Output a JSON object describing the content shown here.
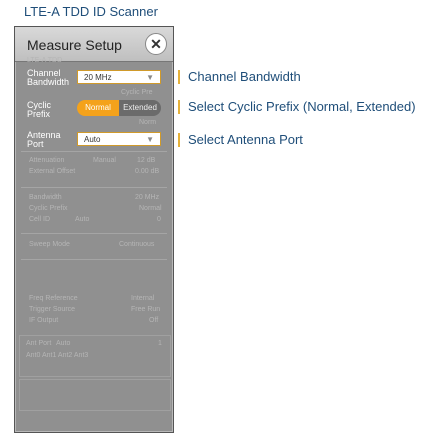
{
  "app_title": "LTE-A TDD ID Scanner",
  "panel": {
    "title": "Measure Setup",
    "close_symbol": "✕",
    "header_faint": "LTE-A TDD",
    "channel_bandwidth": {
      "label_line1": "Channel",
      "label_line2": "Bandwidth",
      "value": "20 MHz"
    },
    "cyclic_prefix": {
      "label_line1": "Cyclic",
      "label_line2": "Prefix",
      "options": [
        "Normal",
        "Extended"
      ],
      "selected": "Normal",
      "faint_above": "Cyclic Pre",
      "faint_below": "Norm"
    },
    "antenna_port": {
      "label_line1": "Antenna",
      "label_line2": "Port",
      "value": "Auto"
    },
    "faint_rows": [
      {
        "label": "Attenuation",
        "mid": "Manual",
        "value": "12 dB"
      },
      {
        "label": "External Offset",
        "mid": "",
        "value": "0.00 dB"
      },
      {
        "label": "Bandwidth",
        "mid": "",
        "value": "20 MHz"
      },
      {
        "label": "Cyclic Prefix",
        "mid": "",
        "value": "Normal"
      },
      {
        "label": "Cell ID",
        "mid": "Auto",
        "value": "0"
      },
      {
        "label": "Sweep Mode",
        "mid": "",
        "value": "Continuous"
      },
      {
        "label": "Freq Reference",
        "mid": "",
        "value": "Internal"
      },
      {
        "label": "Trigger Source",
        "mid": "",
        "value": "Free Run"
      },
      {
        "label": "IF Output",
        "mid": "",
        "value": "Off"
      },
      {
        "label": "Ant Port",
        "mid": "Auto",
        "value": "1"
      }
    ],
    "ant_symbols": "Ant0 Ant1 Ant2 Ant3"
  },
  "callouts": {
    "bandwidth": "Channel Bandwidth",
    "cyclic_prefix": "Select Cyclic Prefix (Normal, Extended)",
    "antenna_port": "Select Antenna Port"
  },
  "colors": {
    "accent": "#f4a21b",
    "callout_text": "#1f4e79",
    "panel_bg": "#909090"
  }
}
